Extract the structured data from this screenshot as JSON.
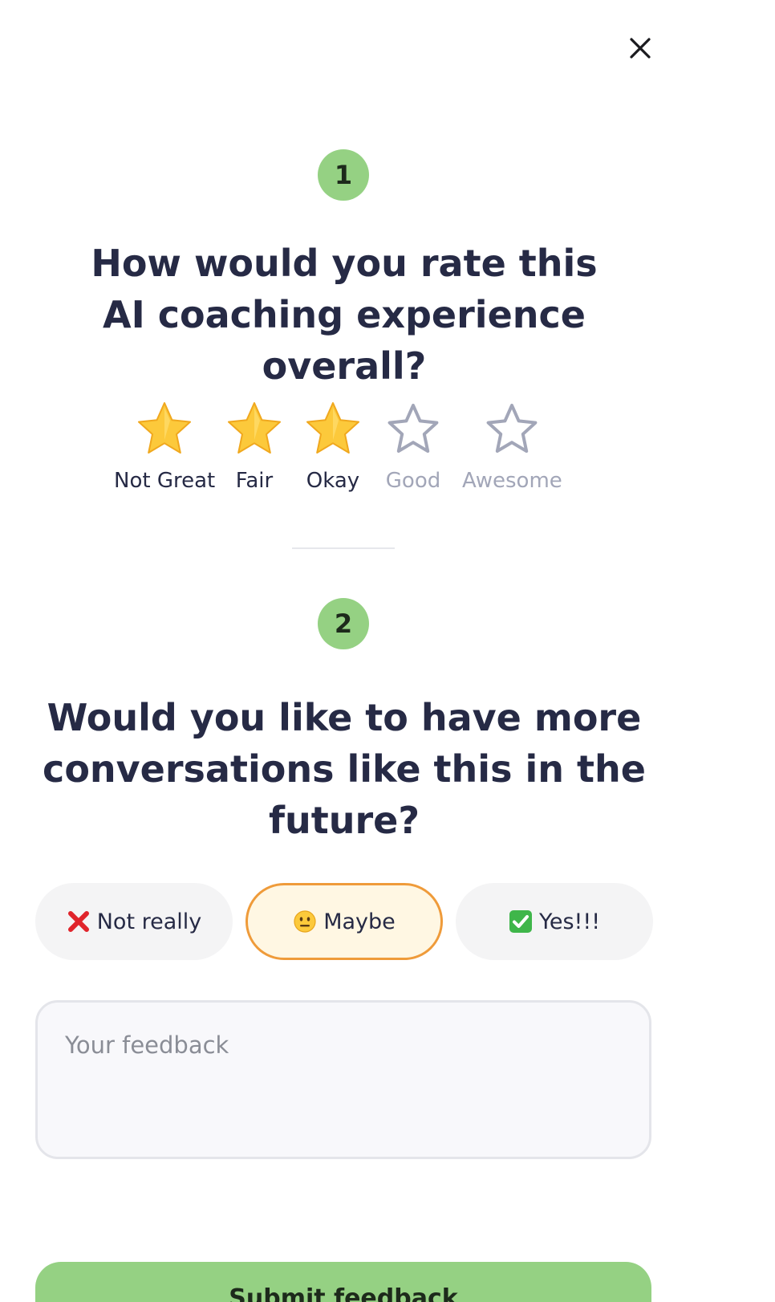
{
  "header": {
    "close_icon": "close-icon"
  },
  "question1": {
    "step_number": "1",
    "line1": "How would you rate this",
    "line2": "AI coaching experience overall?",
    "selected_rating": 3,
    "max_rating": 5,
    "options": [
      {
        "label": "Not Great",
        "filled": true
      },
      {
        "label": "Fair",
        "filled": true
      },
      {
        "label": "Okay",
        "filled": true
      },
      {
        "label": "Good",
        "filled": false
      },
      {
        "label": "Awesome",
        "filled": false
      }
    ]
  },
  "question2": {
    "step_number": "2",
    "line1": "Would you like to have more",
    "line2": "conversations like this in the",
    "line3": "future?",
    "choices": [
      {
        "label": "Not really",
        "icon": "cross-mark-icon",
        "selected": false
      },
      {
        "label": "Maybe",
        "icon": "neutral-face-icon",
        "selected": true
      },
      {
        "label": "Yes!!!",
        "icon": "check-mark-button-icon",
        "selected": false
      }
    ]
  },
  "feedback": {
    "placeholder": "Your feedback",
    "value": ""
  },
  "submit": {
    "label": "Submit feedback"
  },
  "colors": {
    "badge": "#95d183",
    "text": "#262a45",
    "selected_border": "#ef9b3a",
    "selected_bg": "#fff7e3",
    "star_fill": "#fcc93b",
    "star_outline": "#a2a6b8"
  }
}
